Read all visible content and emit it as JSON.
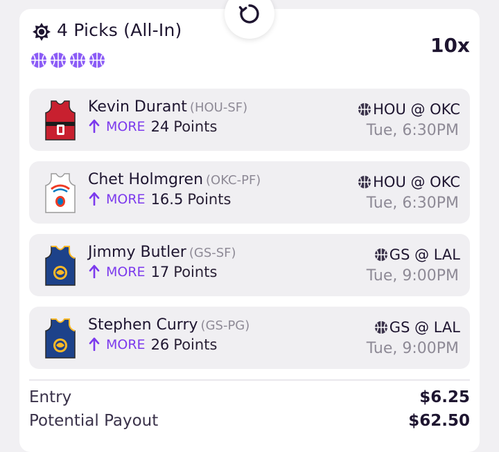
{
  "header": {
    "title": "4 Picks (All-In)",
    "multiplier": "10x",
    "ball_count": 4,
    "icon": "gear-sun-icon",
    "refresh_icon": "refresh-icon"
  },
  "picks": [
    {
      "player": "Kevin Durant",
      "team_pos": "(HOU-SF)",
      "direction": "MORE",
      "value": "24",
      "metric": "Points",
      "matchup": "HOU @ OKC",
      "time": "Tue, 6:30PM",
      "jersey_color": "#c8202f",
      "jersey_number": "0"
    },
    {
      "player": "Chet Holmgren",
      "team_pos": "(OKC-PF)",
      "direction": "MORE",
      "value": "16.5",
      "metric": "Points",
      "matchup": "HOU @ OKC",
      "time": "Tue, 6:30PM",
      "jersey_color": "#ffffff"
    },
    {
      "player": "Jimmy Butler",
      "team_pos": "(GS-SF)",
      "direction": "MORE",
      "value": "17",
      "metric": "Points",
      "matchup": "GS @ LAL",
      "time": "Tue, 9:00PM",
      "jersey_color": "#1d428a"
    },
    {
      "player": "Stephen Curry",
      "team_pos": "(GS-PG)",
      "direction": "MORE",
      "value": "26",
      "metric": "Points",
      "matchup": "GS @ LAL",
      "time": "Tue, 9:00PM",
      "jersey_color": "#1d428a"
    }
  ],
  "footer": {
    "entry_label": "Entry",
    "entry_value": "$6.25",
    "payout_label": "Potential Payout",
    "payout_value": "$62.50"
  },
  "colors": {
    "accent": "#7c3aed",
    "ball": "#8b5cf6",
    "muted_text": "#8e8a96",
    "row_bg": "#f0eff2"
  }
}
